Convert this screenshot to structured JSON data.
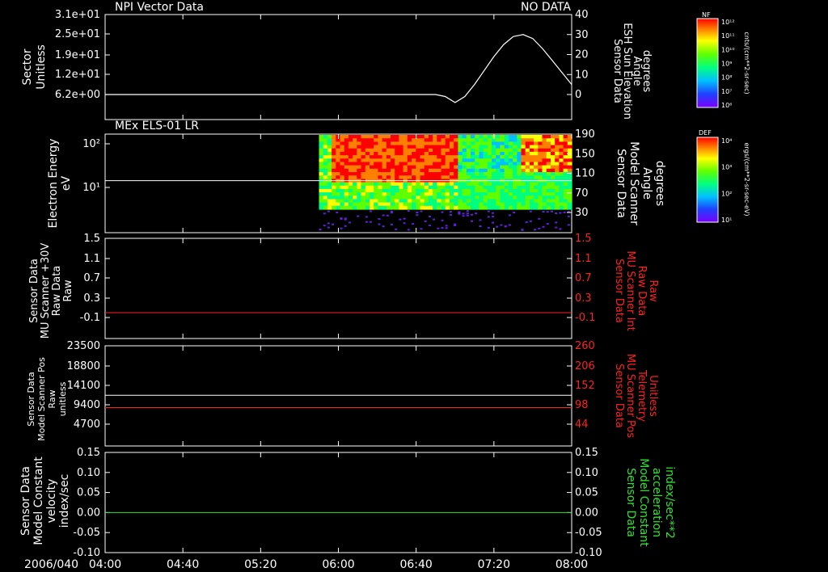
{
  "chart_data": [
    {
      "type": "line",
      "title": "NPI Vector Data",
      "status": "NO DATA",
      "ylabel_left": [
        "Sector",
        "Unitless"
      ],
      "yticks_left": [
        "3.1e+01",
        "2.5e+01",
        "1.9e+01",
        "1.2e+01",
        "6.2e+00"
      ],
      "ylabel_right": [
        "Sensor Data",
        "ESH Sun Elevation",
        "Angle",
        "degrees"
      ],
      "yticks_right": [
        "40",
        "30",
        "20",
        "10",
        "0"
      ],
      "ylim_right": [
        -10,
        40
      ],
      "series": [
        {
          "color": "#ffffff",
          "x": [
            "04:00",
            "05:00",
            "06:00",
            "06:50",
            "06:55",
            "07:00",
            "07:05",
            "07:10",
            "07:15",
            "07:20",
            "07:25",
            "07:30",
            "07:35",
            "07:40",
            "07:45",
            "07:50",
            "07:55",
            "08:00"
          ],
          "y": [
            0,
            0,
            0,
            0,
            -1,
            -4,
            -1,
            5,
            12,
            19,
            25,
            29,
            30,
            28,
            23,
            17,
            11,
            5
          ]
        }
      ]
    },
    {
      "type": "heatmap",
      "title": "MEx ELS-01 LR",
      "ylabel_left": [
        "Electron Energy",
        "eV"
      ],
      "yticks_left": [
        "10²",
        "10¹"
      ],
      "ylabel_right": [
        "Sensor Data",
        "Model Scanner",
        "Angle",
        "degrees"
      ],
      "yticks_right": [
        "190",
        "150",
        "110",
        "70",
        "30"
      ],
      "data_start": "05:50",
      "line_right_value": 95,
      "colorbar": {
        "label": "DEF",
        "units": "ergs/(cm**2-sr-sec-eV)",
        "ticks": [
          "10⁴",
          "10³",
          "10²",
          "10¹"
        ]
      }
    },
    {
      "type": "line",
      "ylabel_left": [
        "Sensor Data",
        "MU Scanner +30V",
        "Raw Data",
        "Raw"
      ],
      "yticks_left": [
        "1.5",
        "1.1",
        "0.7",
        "0.3",
        "-0.1"
      ],
      "ylabel_right": [
        "Sensor Data",
        "MU Scanner Int",
        "Raw Data",
        "Raw"
      ],
      "yticks_right": [
        "1.5",
        "1.1",
        "0.7",
        "0.3",
        "-0.1"
      ],
      "ylim": [
        -0.3,
        1.5
      ],
      "series": [
        {
          "color": "#ff2020",
          "value": 0.0
        }
      ]
    },
    {
      "type": "line",
      "ylabel_left": [
        "Sensor Data",
        "Model Scanner Pos",
        "Raw",
        "unitless"
      ],
      "yticks_left": [
        "23500",
        "18800",
        "14100",
        "9400",
        "4700"
      ],
      "ylabel_right": [
        "Sensor Data",
        "MU Scanner Pos",
        "Telemetry",
        "Unitless"
      ],
      "yticks_right": [
        "260",
        "206",
        "152",
        "98",
        "44"
      ],
      "ylim_left": [
        0,
        23500
      ],
      "series": [
        {
          "color": "#ffffff",
          "value": 11900,
          "axis": "left"
        },
        {
          "color": "#ff2020",
          "value": 90,
          "axis": "right"
        }
      ]
    },
    {
      "type": "line",
      "ylabel_left": [
        "Sensor Data",
        "Model Constant",
        "velocity",
        "index/sec"
      ],
      "yticks_left": [
        "0.15",
        "0.10",
        "0.05",
        "0.00",
        "-0.05",
        "-0.10"
      ],
      "ylabel_right": [
        "Sensor Data",
        "Model Constant",
        "acceleration",
        "index/sec**2"
      ],
      "yticks_right": [
        "0.15",
        "0.10",
        "0.05",
        "0.00",
        "-0.05",
        "-0.10"
      ],
      "ylim": [
        -0.1,
        0.15
      ],
      "series": [
        {
          "color": "#30e030",
          "value": 0.0
        }
      ]
    }
  ],
  "x_axis": {
    "date_label": "2006/040",
    "ticks": [
      "04:00",
      "04:40",
      "05:20",
      "06:00",
      "06:40",
      "07:20",
      "08:00"
    ]
  },
  "colorbar_top": {
    "label": "NF",
    "units": "cnts/(cm**2-sr-sec)",
    "ticks": [
      "10¹²",
      "10¹¹",
      "10¹⁰",
      "10⁹",
      "10⁸",
      "10⁷",
      "10⁶"
    ]
  },
  "colors": {
    "red_label": "#ff2020",
    "green_label": "#30e030"
  }
}
